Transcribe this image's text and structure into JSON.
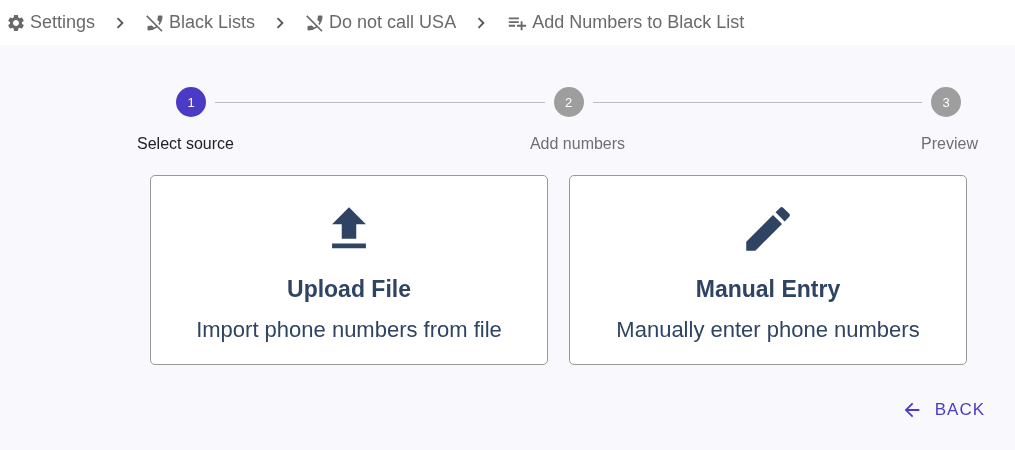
{
  "breadcrumb": [
    {
      "kind": "settings",
      "label": "Settings"
    },
    {
      "kind": "phone-off",
      "label": "Black Lists"
    },
    {
      "kind": "phone-off",
      "label": "Do not call USA"
    },
    {
      "kind": "list-add",
      "label": "Add Numbers to Black List"
    }
  ],
  "steps": [
    {
      "number": "1",
      "label": "Select source",
      "selected": true
    },
    {
      "number": "2",
      "label": "Add numbers",
      "selected": false
    },
    {
      "number": "3",
      "label": "Preview",
      "selected": false
    }
  ],
  "options": [
    {
      "kind": "upload",
      "title": "Upload File",
      "subtitle": "Import phone numbers from file"
    },
    {
      "kind": "edit",
      "title": "Manual Entry",
      "subtitle": "Manually enter phone numbers"
    }
  ],
  "back_button": {
    "label": "BACK"
  }
}
